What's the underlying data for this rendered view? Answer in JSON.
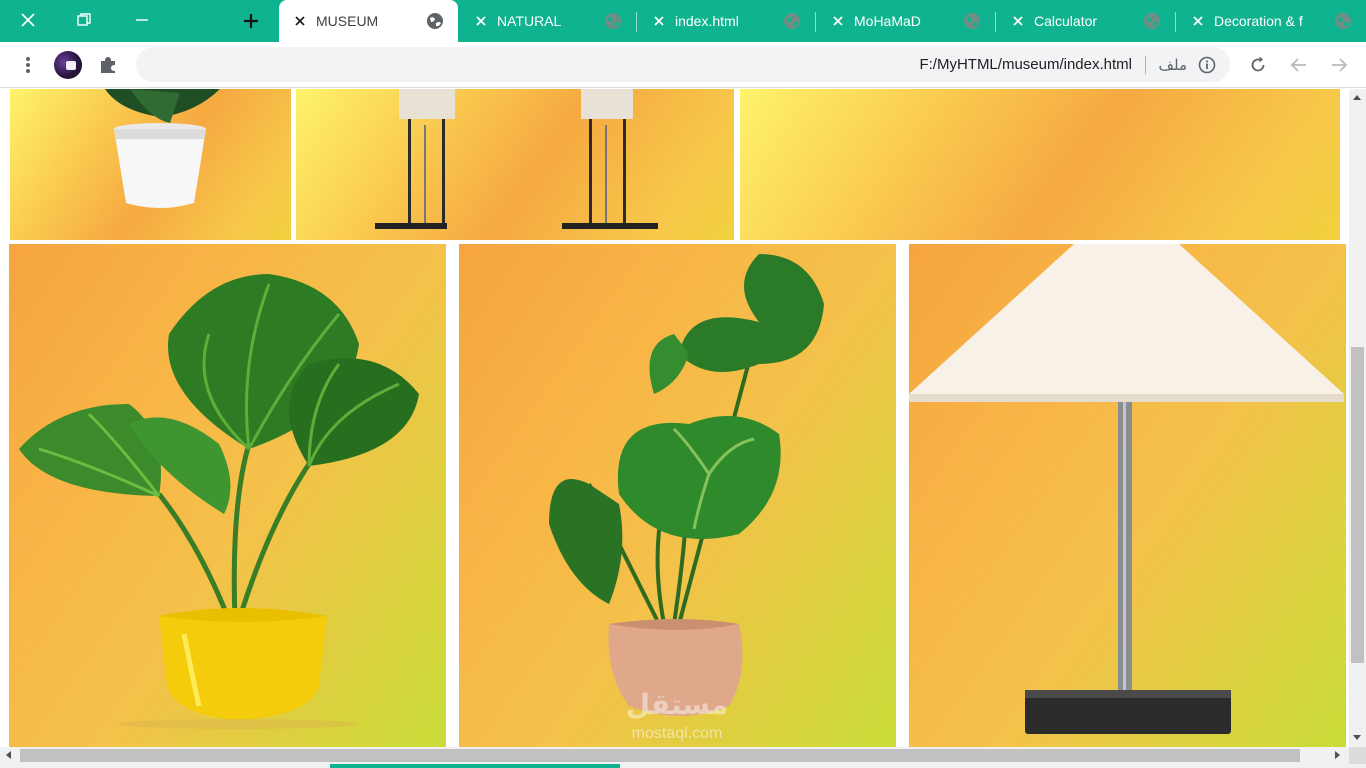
{
  "colors": {
    "tab_strip": "#0fb38f",
    "active_tab": "#ffffff",
    "omnibox": "#f1f3f4"
  },
  "tabs": [
    {
      "title": "MUSEUM",
      "active": true
    },
    {
      "title": "NATURAL",
      "active": false
    },
    {
      "title": "index.html",
      "active": false
    },
    {
      "title": "MoHaMaD",
      "active": false
    },
    {
      "title": "Calculator",
      "active": false
    },
    {
      "title": "Decoration & f",
      "active": false
    }
  ],
  "omnibox": {
    "url": "F:/MyHTML/museum/index.html",
    "scheme_label": "ملف"
  },
  "gallery": {
    "top_row": [
      "potted-plant-white-pot",
      "floor-lamps-pair",
      "empty-gradient-panel"
    ],
    "bottom_row": [
      "fan-palm-yellow-pot",
      "monstera-terracotta-pot",
      "table-lamp-white-shade"
    ]
  },
  "watermark": {
    "line1": "مستقل",
    "line2": "mostaql.com"
  }
}
